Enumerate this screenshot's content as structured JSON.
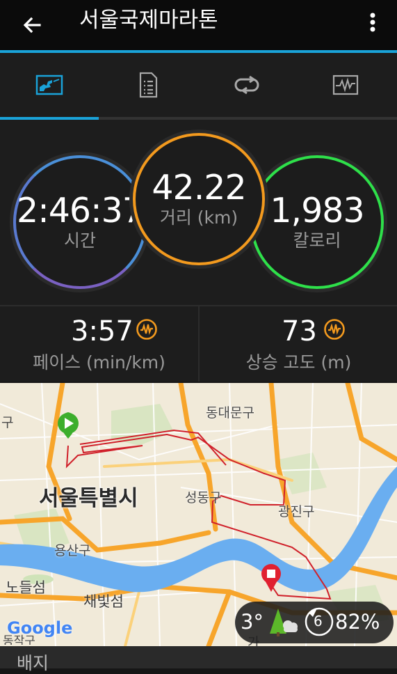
{
  "header": {
    "title": "서울국제마라톤"
  },
  "tabs": [
    {
      "icon": "activity-summary-icon"
    },
    {
      "icon": "details-list-icon"
    },
    {
      "icon": "laps-icon"
    },
    {
      "icon": "charts-icon"
    }
  ],
  "stats": {
    "time": {
      "value": "2:46:37",
      "label": "시간"
    },
    "distance": {
      "value": "42.22",
      "label": "거리 (km)"
    },
    "calories": {
      "value": "1,983",
      "label": "칼로리"
    }
  },
  "metrics": {
    "pace": {
      "value": "3:57",
      "label": "페이스 (min/km)"
    },
    "elevation": {
      "value": "73",
      "label": "상승 고도 (m)"
    }
  },
  "map": {
    "labels": {
      "seoul": "서울특별시",
      "dongdaemun": "동대문구",
      "seongdong": "성동구",
      "gwangjin": "광진구",
      "yongsan": "용산구",
      "nodeulseom": "노들섬",
      "chaebitseom": "채빛섬",
      "partial_gu": "구",
      "partial_bottom": "가",
      "partial_bottom_left": "동작구"
    },
    "google": "Google"
  },
  "weather": {
    "temperature": "3°",
    "wind": "6",
    "humidity": "82%"
  },
  "badges": {
    "title": "배지"
  },
  "colors": {
    "accent": "#1aa3d9",
    "time_ring": "#4a8fd8",
    "distance_ring": "#f39a1e",
    "calories_ring": "#2ee04a",
    "pace_icon": "#f39a1e",
    "route": "#d0202a"
  }
}
